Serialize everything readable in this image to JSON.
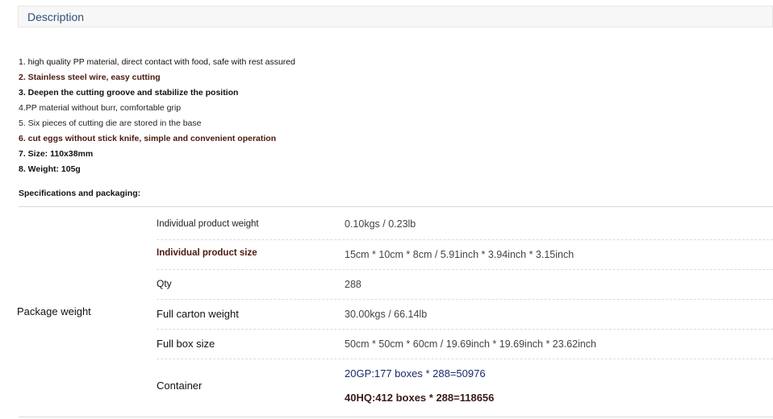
{
  "section": {
    "title": "Description"
  },
  "features": [
    "1. high quality PP material, direct contact with food, safe with rest assured",
    "2. Stainless steel wire, easy cutting",
    "3. Deepen the cutting groove and stabilize the position",
    "4.PP material without burr, comfortable grip",
    "5. Six pieces of cutting die are stored in the base",
    "6. cut eggs without stick knife, simple and convenient operation",
    "7. Size: 110x38mm",
    "8. Weight: 105g"
  ],
  "specs": {
    "heading": "Specifications and packaging:",
    "group_label": "Package weight",
    "rows": [
      {
        "label": "Individual product weight",
        "value": "0.10kgs / 0.23lb"
      },
      {
        "label": "Individual product size",
        "value": "15cm * 10cm * 8cm / 5.91inch * 3.94inch * 3.15inch"
      },
      {
        "label": "Qty",
        "value": "288"
      },
      {
        "label": "Full carton weight",
        "value": "30.00kgs / 66.14lb"
      },
      {
        "label": "Full box size",
        "value": "50cm * 50cm * 60cm / 19.69inch * 19.69inch * 23.62inch"
      },
      {
        "label": "Container",
        "values": [
          "20GP:177 boxes * 288=50976",
          "40HQ:412 boxes * 288=118656"
        ]
      }
    ]
  },
  "colors": {
    "header_bg": "#f7f7f7",
    "title_color": "#2f4f77",
    "accent_brown": "#4a1a10",
    "container_blue": "#1a2a6a"
  }
}
